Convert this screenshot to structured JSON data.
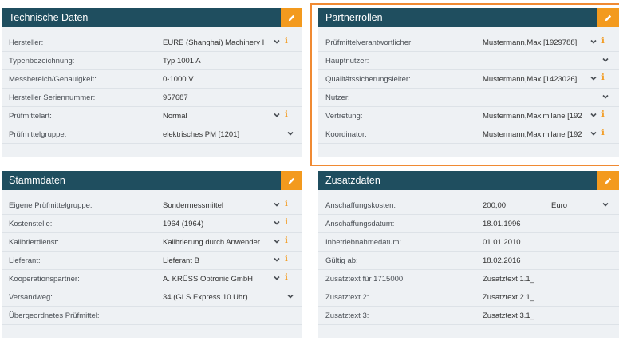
{
  "technische_daten": {
    "title": "Technische Daten",
    "rows": [
      {
        "label": "Hersteller:",
        "value": "EURE (Shanghai) Machinery I",
        "dropdown": true,
        "info": true
      },
      {
        "label": "Typenbezeichnung:",
        "value": "Typ 1001 A",
        "dropdown": false,
        "info": false
      },
      {
        "label": "Messbereich/Genauigkeit:",
        "value": "0-1000 V",
        "dropdown": false,
        "info": false
      },
      {
        "label": "Hersteller Seriennummer:",
        "value": "957687",
        "dropdown": false,
        "info": false
      },
      {
        "label": "Prüfmittelart:",
        "value": "Normal",
        "dropdown": true,
        "info": true
      },
      {
        "label": "Prüfmittelgruppe:",
        "value": "elektrisches PM [1201]",
        "dropdown": true,
        "info": false
      }
    ]
  },
  "partnerrollen": {
    "title": "Partnerrollen",
    "rows": [
      {
        "label": "Prüfmittelverantwortlicher:",
        "value": "Mustermann,Max [1929788]",
        "dropdown": true,
        "info": true
      },
      {
        "label": "Hauptnutzer:",
        "value": "",
        "dropdown": true,
        "info": false
      },
      {
        "label": "Qualitätssicherungsleiter:",
        "value": "Mustermann,Max [1423026]",
        "dropdown": true,
        "info": true
      },
      {
        "label": "Nutzer:",
        "value": "",
        "dropdown": true,
        "info": false
      },
      {
        "label": "Vertretung:",
        "value": "Mustermann,Maximilane [192",
        "dropdown": true,
        "info": true
      },
      {
        "label": "Koordinator:",
        "value": "Mustermann,Maximilane [192",
        "dropdown": true,
        "info": true
      }
    ]
  },
  "stammdaten": {
    "title": "Stammdaten",
    "rows": [
      {
        "label": "Eigene Prüfmittelgruppe:",
        "value": "Sondermessmittel",
        "dropdown": true,
        "info": true
      },
      {
        "label": "Kostenstelle:",
        "value": "1964 (1964)",
        "dropdown": true,
        "info": true
      },
      {
        "label": "Kalibrierdienst:",
        "value": "Kalibrierung durch Anwender",
        "dropdown": true,
        "info": true
      },
      {
        "label": "Lieferant:",
        "value": "Lieferant B",
        "dropdown": true,
        "info": true
      },
      {
        "label": "Kooperationspartner:",
        "value": "A. KRÜSS Optronic GmbH",
        "dropdown": true,
        "info": true
      },
      {
        "label": "Versandweg:",
        "value": "34 (GLS Express 10 Uhr)",
        "dropdown": true,
        "info": false
      },
      {
        "label": "Übergeordnetes Prüfmittel:",
        "value": "",
        "dropdown": false,
        "info": false
      }
    ]
  },
  "zusatzdaten": {
    "title": "Zusatzdaten",
    "rows": [
      {
        "label": "Anschaffungskosten:",
        "value": "200,00",
        "extra": "Euro",
        "dropdown": true,
        "info": false
      },
      {
        "label": "Anschaffungsdatum:",
        "value": "18.01.1996",
        "dropdown": false,
        "info": false
      },
      {
        "label": "Inbetriebnahmedatum:",
        "value": "01.01.2010",
        "dropdown": false,
        "info": false
      },
      {
        "label": "Gültig ab:",
        "value": "18.02.2016",
        "dropdown": false,
        "info": false
      },
      {
        "label": "Zusatztext für 1715000:",
        "value": "Zusatztext 1.1_",
        "dropdown": false,
        "info": false
      },
      {
        "label": "Zusatztext 2:",
        "value": "Zusatztext 2.1_",
        "dropdown": false,
        "info": false
      },
      {
        "label": "Zusatztext 3:",
        "value": "Zusatztext 3.1_",
        "dropdown": false,
        "info": false
      }
    ]
  },
  "icons": {
    "edit": "pencil-icon",
    "dropdown": "chevron-down-icon",
    "info": "info-icon"
  },
  "colors": {
    "header": "#1f4e5f",
    "accent": "#f39a1e",
    "panel_bg": "#eef1f4",
    "highlight_border": "#f08a33"
  }
}
